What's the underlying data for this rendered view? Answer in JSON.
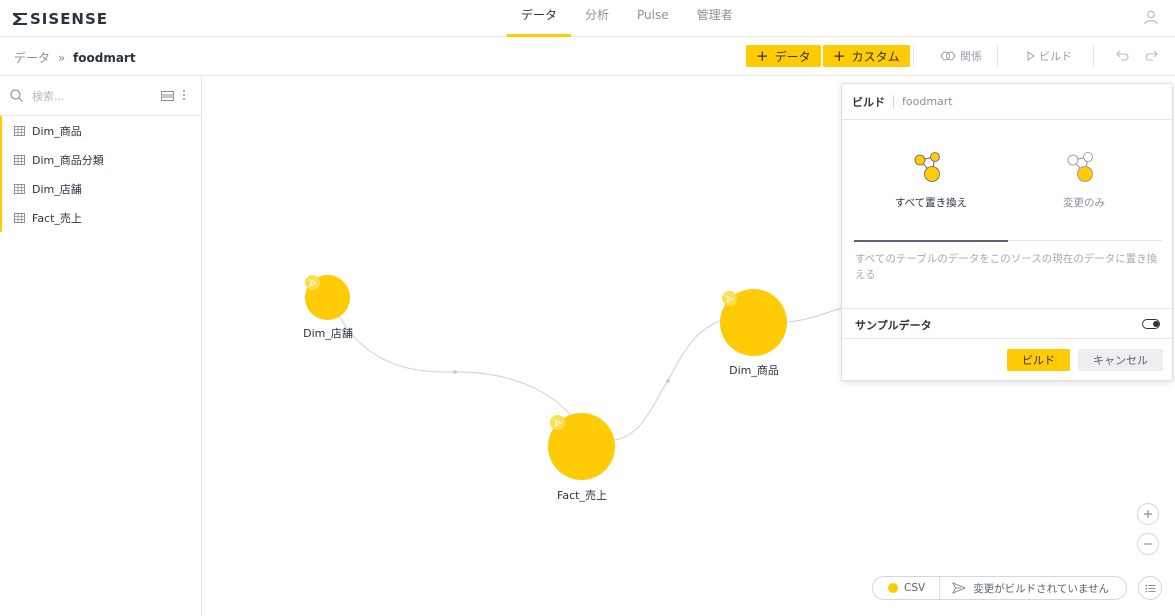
{
  "app": {
    "logo_text": "SISENSE"
  },
  "nav": {
    "tabs": [
      {
        "label": "データ"
      },
      {
        "label": "分析"
      },
      {
        "label": "Pulse"
      },
      {
        "label": "管理者"
      }
    ],
    "active_tab": "データ"
  },
  "toolbar": {
    "breadcrumb_root": "データ",
    "breadcrumb_sep": "»",
    "breadcrumb_current": "foodmart",
    "add_data_label": "データ",
    "add_custom_label": "カスタム",
    "relations_label": "関係",
    "build_label": "ビルド"
  },
  "sidebar": {
    "search_placeholder": "検索...",
    "tables": [
      {
        "label": "Dim_商品"
      },
      {
        "label": "Dim_商品分類"
      },
      {
        "label": "Dim_店舗"
      },
      {
        "label": "Fact_売上"
      }
    ]
  },
  "canvas": {
    "nodes": [
      {
        "label": "Dim_店舗"
      },
      {
        "label": "Fact_売上"
      },
      {
        "label": "Dim_商品"
      }
    ],
    "status": {
      "source": "CSV",
      "message": "変更がビルドされていません"
    }
  },
  "build_panel": {
    "title": "ビルド",
    "subtitle": "foodmart",
    "option_replace_all": "すべて置き換え",
    "option_changes_only": "変更のみ",
    "selected_option": "すべて置き換え",
    "description": "すべてのテーブルのデータをこのソースの現在のデータに置き換える",
    "sample_data_label": "サンプルデータ",
    "sample_data_enabled": false,
    "build_button": "ビルド",
    "cancel_button": "キャンセル"
  },
  "colors": {
    "accent": "#ffcb05",
    "text_dark": "#2a3340",
    "text_muted": "#8a919c"
  }
}
